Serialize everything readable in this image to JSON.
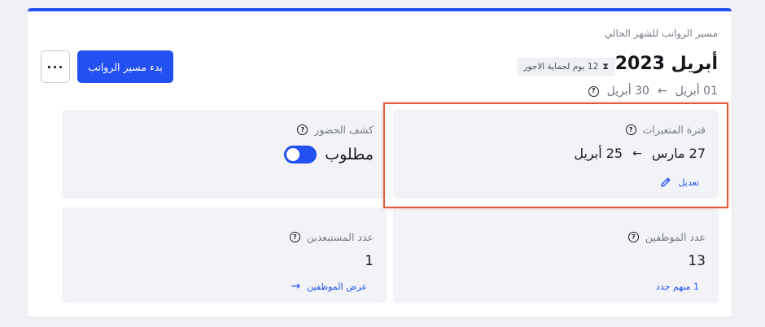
{
  "header": {
    "eyebrow": "مسير الرواتب للشهر الحالي",
    "month_title": "أبريل 2023",
    "protection_badge": "12 يوم لحماية الاجور",
    "range_start": "01 أبريل",
    "range_end": "30 أبريل"
  },
  "actions": {
    "start_payroll": "بدء مسير الرواتب",
    "more": "···"
  },
  "tiles": {
    "changes_period": {
      "label": "فترة المتغيرات",
      "from": "27 مارس",
      "to": "25 أبريل",
      "edit_link": "تعديل"
    },
    "attendance_sheet": {
      "label": "كشف الحضور",
      "value": "مطلوب",
      "toggle_on": true
    },
    "employees_count": {
      "label": "عدد الموظفين",
      "value": "13",
      "link": "1 منهم جدد"
    },
    "excluded_count": {
      "label": "عدد المستبعدين",
      "value": "1",
      "link": "عرض الموظفين"
    }
  },
  "colors": {
    "accent": "#2350f0",
    "highlight": "#e05a42"
  }
}
